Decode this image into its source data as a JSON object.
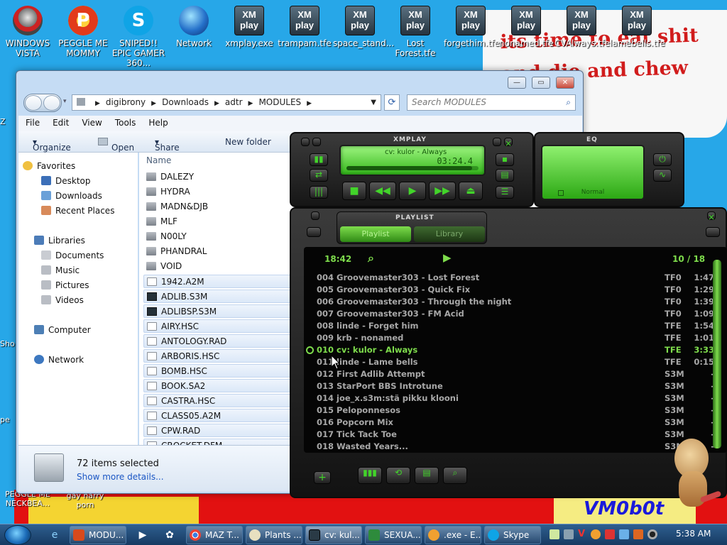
{
  "desktop": {
    "icons": [
      {
        "label": "WINDOWS VISTA",
        "icon": "windows-vista-icon"
      },
      {
        "label": "PEGGLE ME MOMMY",
        "icon": "peggle-icon"
      },
      {
        "label": "SNIPED!! EPIC GAMER 360...",
        "icon": "skype-icon"
      },
      {
        "label": "Network",
        "icon": "network-icon"
      },
      {
        "label": "xmplay.exe",
        "icon": "xmplay-icon"
      },
      {
        "label": "trampam.tfe",
        "icon": "xmplay-icon"
      },
      {
        "label": "space_stand...",
        "icon": "xmplay-icon"
      },
      {
        "label": "Lost Forest.tfe",
        "icon": "xmplay-icon"
      },
      {
        "label": "forgethim.tfe",
        "icon": "xmplay-icon"
      },
      {
        "label": "nonamed.tfe",
        "icon": "xmplay-icon"
      },
      {
        "label": "CVAlways.tfe",
        "icon": "xmplay-icon"
      },
      {
        "label": "lamebells.tfe",
        "icon": "xmplay-icon"
      }
    ],
    "xm_icon_text_top": "XM",
    "xm_icon_text_bottom": "play",
    "partial_labels": {
      "left1": "Z",
      "left2": "Sho",
      "left3": "pe",
      "bottom_left": "PEGGLE ME NECKBEA...",
      "bottom2": "gay harry porn"
    },
    "wallpaper_text": "its time to eat shit and die and chew gum",
    "wallpaper_signature": "VM0b0t"
  },
  "explorer": {
    "breadcrumb": [
      "digibrony",
      "Downloads",
      "adtr",
      "MODULES"
    ],
    "search_placeholder": "Search MODULES",
    "menu": [
      "File",
      "Edit",
      "View",
      "Tools",
      "Help"
    ],
    "commands": {
      "organize": "Organize",
      "open": "Open",
      "share": "Share with",
      "new_folder": "New folder"
    },
    "nav": {
      "favorites": "Favorites",
      "desktop": "Desktop",
      "downloads": "Downloads",
      "recent": "Recent Places",
      "libraries": "Libraries",
      "documents": "Documents",
      "music": "Music",
      "pictures": "Pictures",
      "videos": "Videos",
      "computer": "Computer",
      "network": "Network"
    },
    "column_name": "Name",
    "files": [
      {
        "name": "DALEZY",
        "type": "folder"
      },
      {
        "name": "HYDRA",
        "type": "folder"
      },
      {
        "name": "MADN&DJB",
        "type": "folder"
      },
      {
        "name": "MLF",
        "type": "folder"
      },
      {
        "name": "N00LY",
        "type": "folder"
      },
      {
        "name": "PHANDRAL",
        "type": "folder"
      },
      {
        "name": "VOID",
        "type": "folder"
      },
      {
        "name": "1942.A2M",
        "type": "file"
      },
      {
        "name": "ADLIB.S3M",
        "type": "xm"
      },
      {
        "name": "ADLIBSP.S3M",
        "type": "xm"
      },
      {
        "name": "AIRY.HSC",
        "type": "file"
      },
      {
        "name": "ANTOLOGY.RAD",
        "type": "file"
      },
      {
        "name": "ARBORIS.HSC",
        "type": "file"
      },
      {
        "name": "BOMB.HSC",
        "type": "file"
      },
      {
        "name": "BOOK.SA2",
        "type": "file"
      },
      {
        "name": "CASTRA.HSC",
        "type": "file"
      },
      {
        "name": "CLASS05.A2M",
        "type": "file"
      },
      {
        "name": "CPW.RAD",
        "type": "file"
      },
      {
        "name": "CROCKET.DFM",
        "type": "file"
      }
    ],
    "status_count": "72 items selected",
    "status_more": "Show more details..."
  },
  "xmplay": {
    "title": "XMPLAY",
    "lcd_song": "cv: kulor - Always",
    "lcd_time": "03:24.4",
    "eq_title": "EQ",
    "eq_preset": "Normal",
    "playlist_title": "PLAYLIST",
    "tab_playlist": "Playlist",
    "tab_library": "Library",
    "total_time": "18:42",
    "position": "10 / 18",
    "tracks": [
      {
        "name": "004 Groovemaster303 - Lost Forest",
        "type": "TF0",
        "dur": "1:47"
      },
      {
        "name": "005 Groovemaster303 - Quick Fix",
        "type": "TF0",
        "dur": "1:29"
      },
      {
        "name": "006 Groovemaster303 - Through the night",
        "type": "TF0",
        "dur": "1:39"
      },
      {
        "name": "007 Groovemaster303 - FM Acid",
        "type": "TF0",
        "dur": "1:09"
      },
      {
        "name": "008 linde - Forget him",
        "type": "TFE",
        "dur": "1:54"
      },
      {
        "name": "009 krb - nonamed",
        "type": "TFE",
        "dur": "1:01"
      },
      {
        "name": "010 cv: kulor - Always",
        "type": "TFE",
        "dur": "3:33"
      },
      {
        "name": "011 linde - Lame bells",
        "type": "TFE",
        "dur": "0:15"
      },
      {
        "name": "012 First Adlib Attempt",
        "type": "S3M",
        "dur": "-"
      },
      {
        "name": "013 StarPort BBS Introtune",
        "type": "S3M",
        "dur": "-"
      },
      {
        "name": "014 joe_x.s3m:stä pikku klooni",
        "type": "S3M",
        "dur": "-"
      },
      {
        "name": "015 Peloponnesos",
        "type": "S3M",
        "dur": "-"
      },
      {
        "name": "016 Popcorn Mix",
        "type": "S3M",
        "dur": "-"
      },
      {
        "name": "017 Tick Tack Toe",
        "type": "S3M",
        "dur": "-"
      },
      {
        "name": "018 Wasted Years...",
        "type": "S3M",
        "dur": "-"
      }
    ],
    "current_index": 6,
    "progress": 0.95,
    "accent": "#7edc4c"
  },
  "taskbar": {
    "buttons": [
      {
        "label": "MODU...",
        "icon": "explorer-icon"
      },
      {
        "label": "MAZ T...",
        "icon": "chrome-icon"
      },
      {
        "label": "Plants ...",
        "icon": "plants-icon"
      },
      {
        "label": "cv: kul...",
        "icon": "xmplay-icon"
      },
      {
        "label": "SEXUA...",
        "icon": "excel-icon"
      },
      {
        "label": ".exe - E...",
        "icon": "search-app-icon"
      },
      {
        "label": "Skype",
        "icon": "skype-icon"
      }
    ],
    "clock": "5:38 AM"
  }
}
